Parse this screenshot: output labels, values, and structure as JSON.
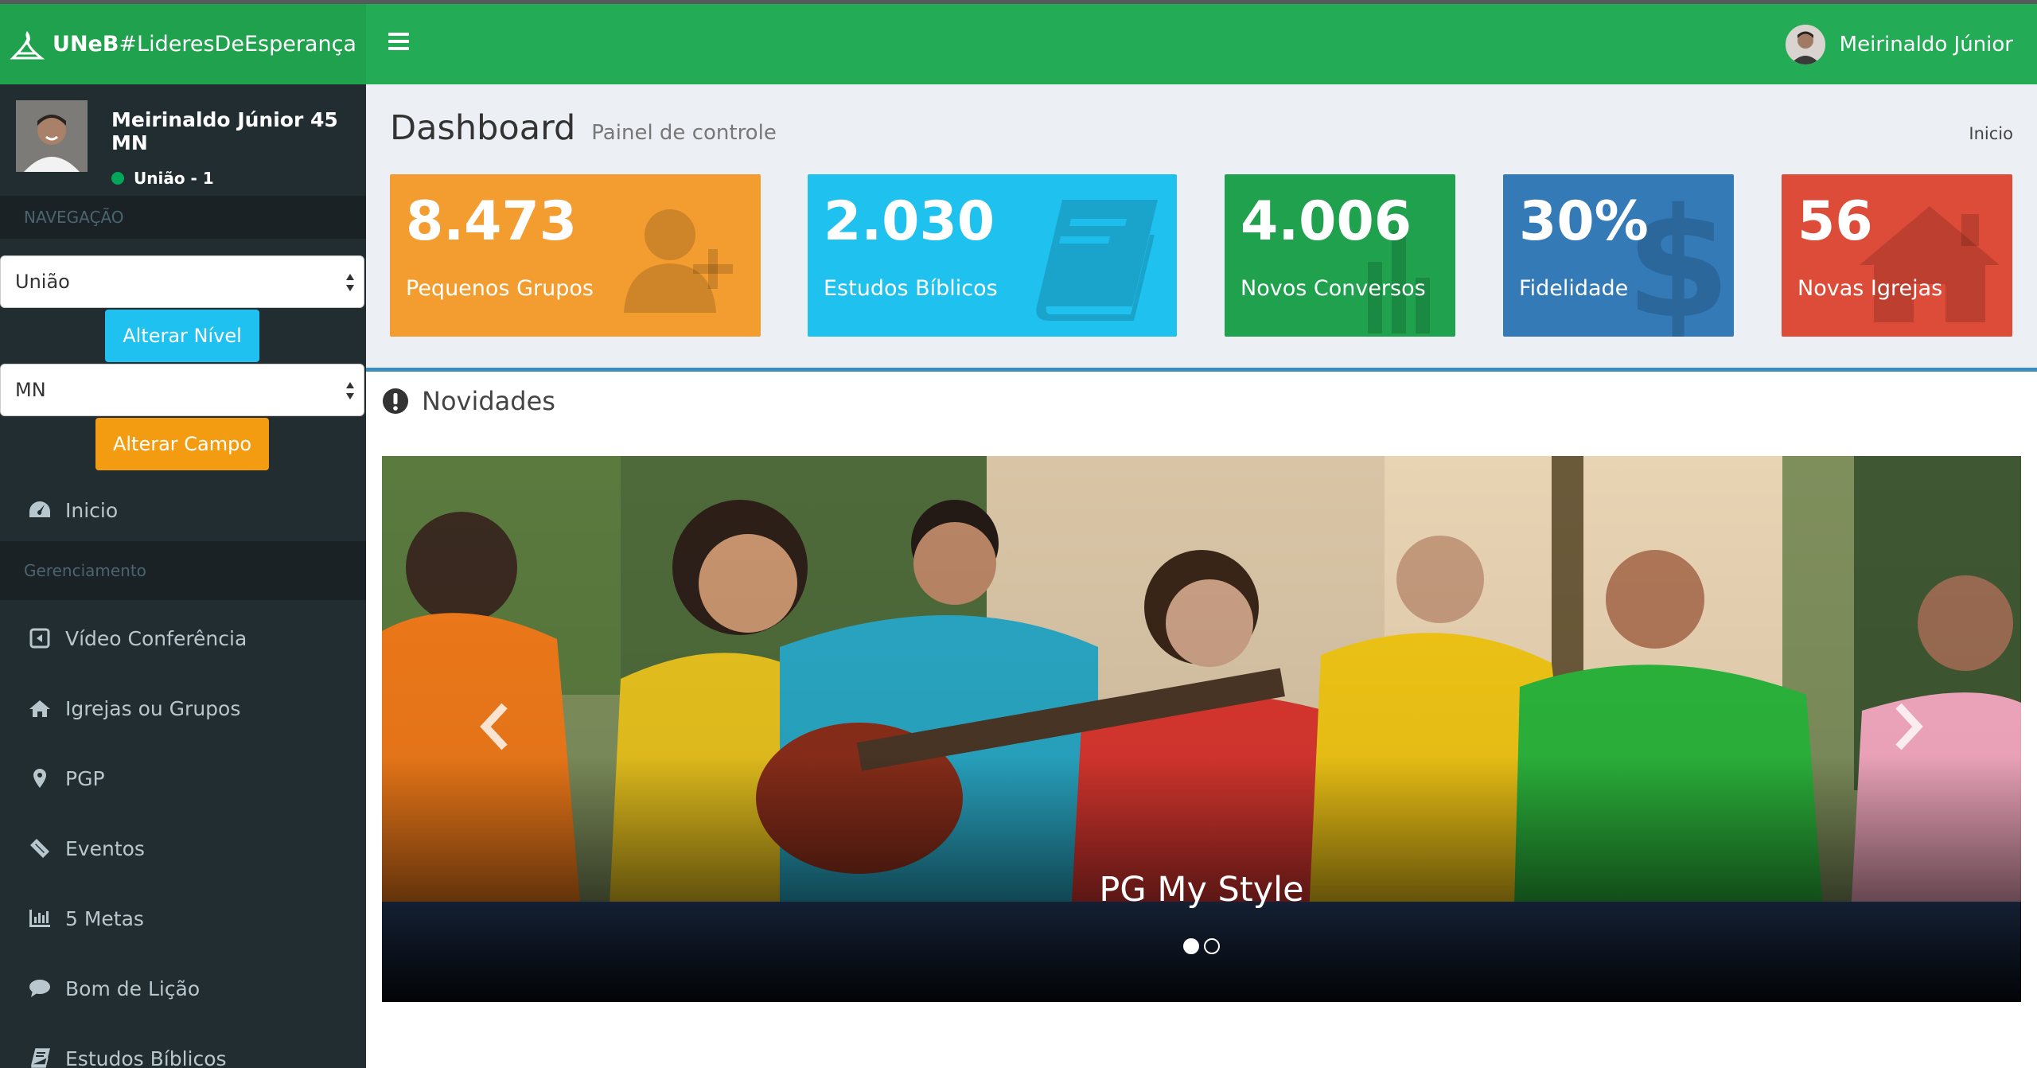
{
  "brand": {
    "bold": "UNeB",
    "light": "#LideresDeEsperança"
  },
  "header": {
    "user_name": "Meirinaldo Júnior"
  },
  "sidebar": {
    "user_name": "Meirinaldo Júnior 45 MN",
    "user_status": "União - 1",
    "nav_header": "NAVEGAÇÃO",
    "level_select": "União",
    "level_button": "Alterar Nível",
    "field_select": "MN",
    "field_button": "Alterar Campo",
    "home_label": "Inicio",
    "mgmt_header": "Gerenciamento",
    "items": [
      {
        "label": "Vídeo Conferência",
        "icon": "video-icon"
      },
      {
        "label": "Igrejas ou Grupos",
        "icon": "home-icon"
      },
      {
        "label": "PGP",
        "icon": "map-marker-icon"
      },
      {
        "label": "Eventos",
        "icon": "ticket-icon"
      },
      {
        "label": "5 Metas",
        "icon": "bar-chart-icon"
      },
      {
        "label": "Bom de Lição",
        "icon": "comment-icon"
      },
      {
        "label": "Estudos Bíblicos",
        "icon": "book-icon"
      }
    ]
  },
  "page": {
    "title": "Dashboard",
    "subtitle": "Painel de controle",
    "breadcrumb": "Inicio"
  },
  "stats": [
    {
      "value": "8.473",
      "label": "Pequenos Grupos",
      "color": "#f39c2f",
      "icon": "user-plus-icon"
    },
    {
      "value": "2.030",
      "label": "Estudos Bíblicos",
      "color": "#1fc1ef",
      "icon": "book-icon"
    },
    {
      "value": "4.006",
      "label": "Novos Conversos",
      "color": "#1fa14d",
      "icon": "bar-chart-icon"
    },
    {
      "value": "30%",
      "label": "Fidelidade",
      "color": "#337ab7",
      "icon": "dollar-icon"
    },
    {
      "value": "56",
      "label": "Novas Igrejas",
      "color": "#dd4b39",
      "icon": "home-icon"
    }
  ],
  "news": {
    "title": "Novidades",
    "slide_caption": "PG My Style",
    "slide_count": 2,
    "active_slide": 1
  }
}
